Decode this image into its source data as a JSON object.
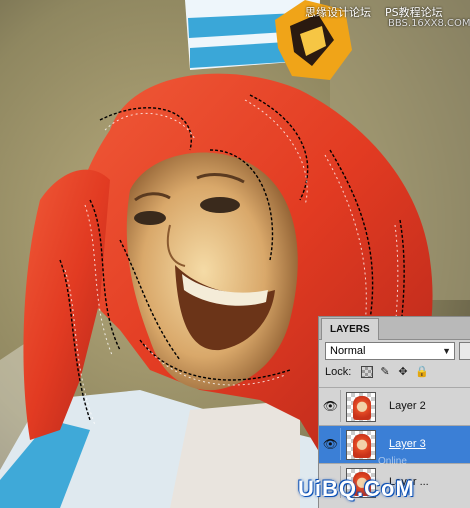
{
  "watermark": {
    "top_left": "思缘设计论坛",
    "top_right": "PS教程论坛",
    "site_small": "BBS.16XX8.COM",
    "bottom_main": "UiBQ.CoM",
    "bottom_accent": "Q",
    "ghost": "Online"
  },
  "layers_panel": {
    "tab_label": "LAYERS",
    "blend_mode": "Normal",
    "lock_label": "Lock:",
    "lock_icons": [
      "lock-transparency-icon",
      "lock-paint-icon",
      "lock-move-icon",
      "lock-all-icon"
    ],
    "layers": [
      {
        "name": "Layer 2",
        "visible": true,
        "selected": false
      },
      {
        "name": "Layer 3",
        "visible": true,
        "selected": true
      },
      {
        "name": "Layer ...",
        "visible": true,
        "selected": false
      }
    ]
  },
  "colors": {
    "selection_blue": "#3b7fd6",
    "hair_red": "#e8412a",
    "panel_gray": "#d4d4d4"
  }
}
